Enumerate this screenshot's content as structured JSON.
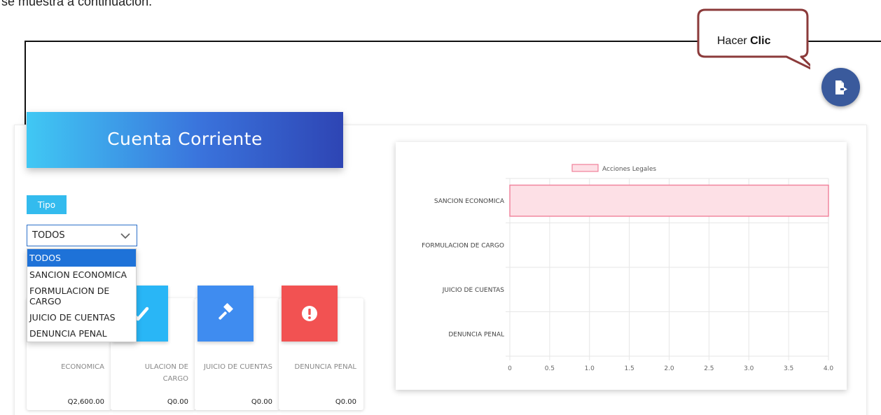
{
  "document": {
    "intro_text": "se muestra a continuación."
  },
  "callout": {
    "prefix": "Hacer ",
    "bold": "Clic"
  },
  "logout_button": {
    "icon": "file-export-icon",
    "color": "#3a5a9c"
  },
  "header": {
    "title": "Cuenta Corriente"
  },
  "filter": {
    "label": "Tipo",
    "selected_value": "TODOS",
    "options": [
      "TODOS",
      "SANCION ECONOMICA",
      "FORMULACION DE CARGO",
      "JUICIO DE CUENTAS",
      "DENUNCIA PENAL"
    ]
  },
  "cards": [
    {
      "name": "SANCION ECONOMICA",
      "visible_name": "ECONOMICA",
      "amount": "Q2,600.00",
      "color": "#4caf50",
      "icon": "money-icon"
    },
    {
      "name": "FORMULACION DE CARGO",
      "visible_name": "ULACION DE CARGO",
      "amount": "Q0.00",
      "color": "#29b6f6",
      "icon": "check-icon"
    },
    {
      "name": "JUICIO DE CUENTAS",
      "visible_name": "JUICIO DE CUENTAS",
      "amount": "Q0.00",
      "color": "#3f8cf0",
      "icon": "gavel-icon"
    },
    {
      "name": "DENUNCIA PENAL",
      "visible_name": "DENUNCIA PENAL",
      "amount": "Q0.00",
      "color": "#f25252",
      "icon": "exclamation-icon"
    }
  ],
  "chart_data": {
    "type": "bar",
    "orientation": "horizontal",
    "categories": [
      "SANCION ECONOMICA",
      "FORMULACION DE CARGO",
      "JUICIO DE CUENTAS",
      "DENUNCIA PENAL"
    ],
    "series": [
      {
        "name": "Acciones Legales",
        "values": [
          4,
          0,
          0,
          0
        ],
        "fill": "#fde0e6",
        "stroke": "#f0809a"
      }
    ],
    "xlim": [
      0,
      4
    ],
    "x_ticks": [
      "0",
      "0.5",
      "1.0",
      "1.5",
      "2.0",
      "2.5",
      "3.0",
      "3.5",
      "4.0"
    ],
    "grid": true,
    "legend_position": "top"
  }
}
